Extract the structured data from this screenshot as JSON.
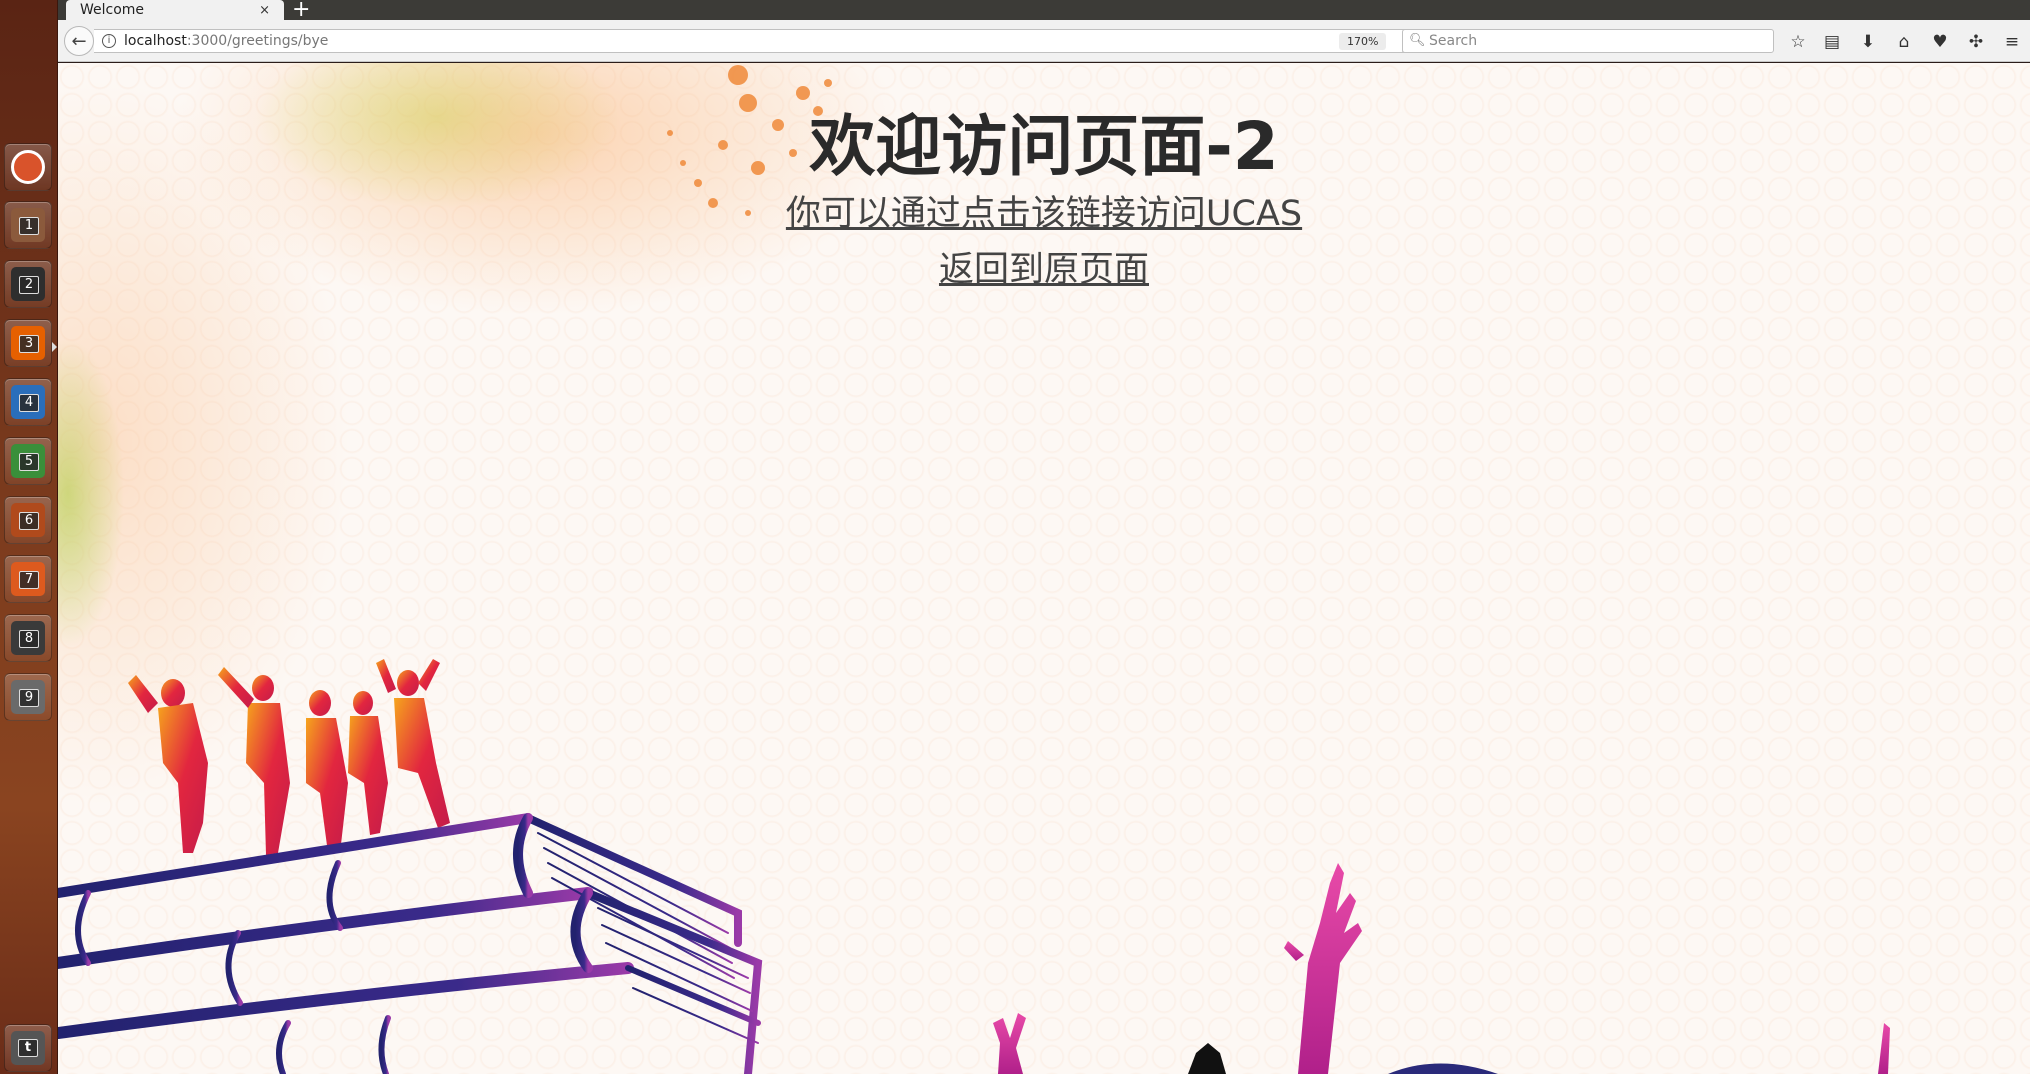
{
  "launcher": {
    "items": [
      {
        "name": "ubuntu-dash-icon",
        "badge": "",
        "color": "#d9532b"
      },
      {
        "name": "files-icon",
        "badge": "1",
        "color": "#8b5a3c"
      },
      {
        "name": "terminal-icon",
        "badge": "2",
        "color": "#2e2e2e"
      },
      {
        "name": "firefox-icon",
        "badge": "3",
        "color": "#e66000"
      },
      {
        "name": "writer-icon",
        "badge": "4",
        "color": "#2a6ebb"
      },
      {
        "name": "calc-icon",
        "badge": "5",
        "color": "#3a8f3a"
      },
      {
        "name": "impress-icon",
        "badge": "6",
        "color": "#b04a1c"
      },
      {
        "name": "software-center-icon",
        "badge": "7",
        "color": "#dd5a1e"
      },
      {
        "name": "amazon-icon",
        "badge": "8",
        "color": "#3a3a3a"
      },
      {
        "name": "settings-icon",
        "badge": "9",
        "color": "#6a6a6a"
      }
    ],
    "trash_badge": "t"
  },
  "browser": {
    "tab_title": "Welcome",
    "tab_close": "×",
    "new_tab": "+",
    "url_host": "localhost",
    "url_path": ":3000/greetings/bye",
    "zoom": "170%",
    "search_placeholder": "Search",
    "toolbar": [
      {
        "name": "bookmark-star-icon",
        "glyph": "☆"
      },
      {
        "name": "reading-list-icon",
        "glyph": "▤"
      },
      {
        "name": "download-icon",
        "glyph": "⬇"
      },
      {
        "name": "home-icon",
        "glyph": "⌂"
      },
      {
        "name": "pocket-icon",
        "glyph": "♥"
      },
      {
        "name": "extension-icon",
        "glyph": "✣"
      },
      {
        "name": "menu-icon",
        "glyph": "≡"
      }
    ]
  },
  "page": {
    "title": "欢迎访问页面-2",
    "link_ucas": "你可以通过点击该链接访问UCAS",
    "link_back": "返回到原页面"
  },
  "colors": {
    "text": "#2a2a2a",
    "link": "#444444",
    "background": "#fdf8f4",
    "splash_orange": "#f08a3a",
    "dancers_red": "#d8263a",
    "books_navy": "#2a2a7a",
    "books_purple": "#8a2a9a"
  }
}
